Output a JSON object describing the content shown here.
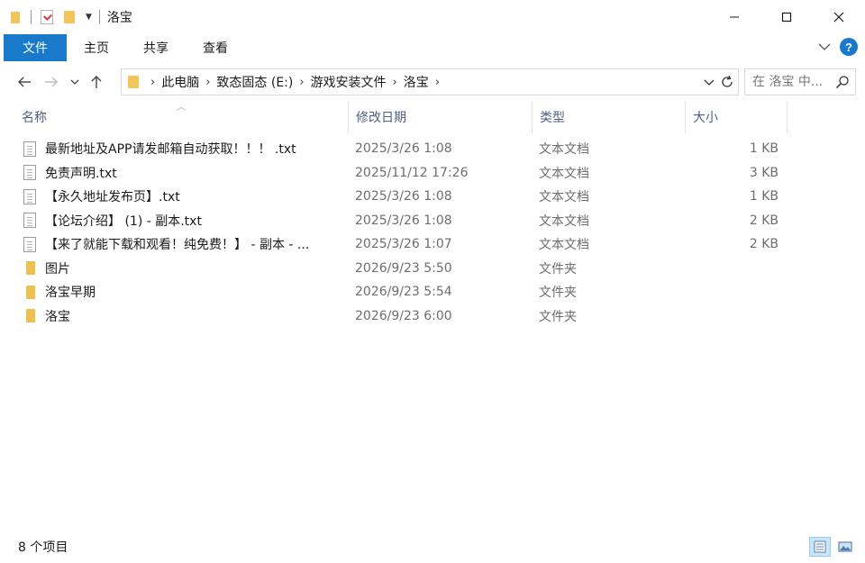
{
  "window": {
    "title": "洛宝"
  },
  "ribbon": {
    "tabs": [
      "文件",
      "主页",
      "共享",
      "查看"
    ]
  },
  "address": {
    "crumbs": [
      "此电脑",
      "致态固态 (E:)",
      "游戏安装文件",
      "洛宝"
    ],
    "search_placeholder": "在 洛宝 中..."
  },
  "columns": {
    "name": "名称",
    "date": "修改日期",
    "type": "类型",
    "size": "大小"
  },
  "files": [
    {
      "icon": "text-file-icon",
      "name": "最新地址及APP请发邮箱自动获取！！！ .txt",
      "date": "2025/3/26 1:08",
      "type": "文本文档",
      "size": "1 KB"
    },
    {
      "icon": "text-file-icon",
      "name": "免责声明.txt",
      "date": "2025/11/12 17:26",
      "type": "文本文档",
      "size": "3 KB"
    },
    {
      "icon": "text-file-icon",
      "name": "【永久地址发布页】.txt",
      "date": "2025/3/26 1:08",
      "type": "文本文档",
      "size": "1 KB"
    },
    {
      "icon": "text-file-icon",
      "name": "【论坛介绍】 (1) - 副本.txt",
      "date": "2025/3/26 1:08",
      "type": "文本文档",
      "size": "2 KB"
    },
    {
      "icon": "text-file-icon",
      "name": "【来了就能下载和观看！纯免费！】 - 副本 - ...",
      "date": "2025/3/26 1:07",
      "type": "文本文档",
      "size": "2 KB"
    },
    {
      "icon": "folder-icon",
      "name": "图片",
      "date": "2026/9/23 5:50",
      "type": "文件夹",
      "size": ""
    },
    {
      "icon": "folder-icon",
      "name": "洛宝早期",
      "date": "2026/9/23 5:54",
      "type": "文件夹",
      "size": ""
    },
    {
      "icon": "folder-icon",
      "name": "洛宝",
      "date": "2026/9/23 6:00",
      "type": "文件夹",
      "size": ""
    }
  ],
  "status": {
    "count_text": "8 个项目"
  },
  "colors": {
    "accent": "#1979ca",
    "folder": "#f0c04f",
    "header_text": "#4d6082",
    "meta_text": "#6d6d6d"
  }
}
